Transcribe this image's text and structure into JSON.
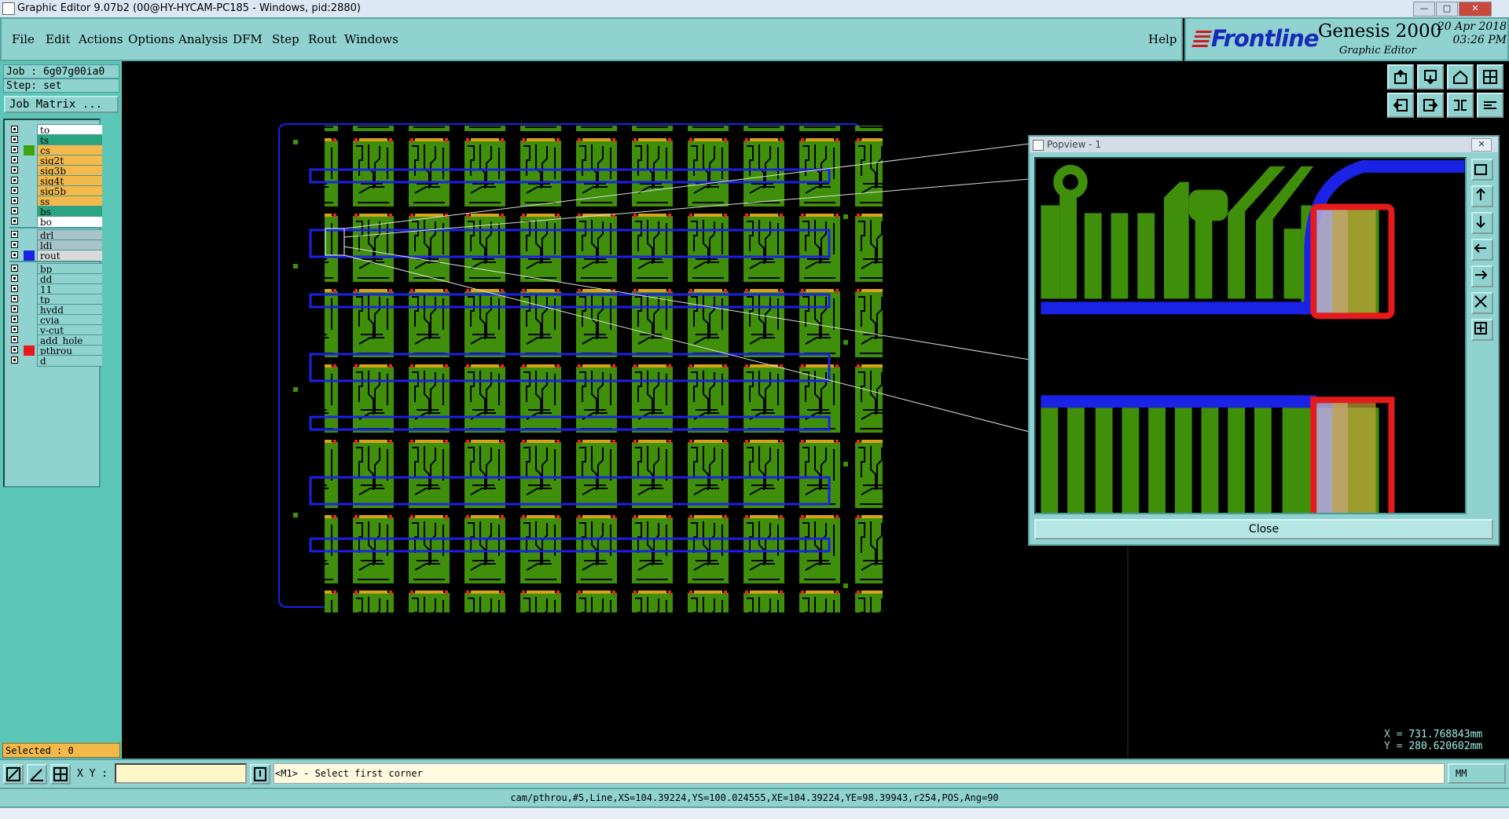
{
  "window": {
    "title": "Graphic Editor 9.07b2 (00@HY-HYCAM-PC185 - Windows, pid:2880)"
  },
  "menu": {
    "items": [
      "File",
      "Edit",
      "Actions",
      "Options",
      "Analysis",
      "DFM",
      "Step",
      "Rout",
      "Windows"
    ],
    "help": "Help"
  },
  "brand": {
    "logo": "Frontline",
    "product": "Genesis 2000",
    "subtitle": "Graphic Editor",
    "date": "20 Apr 2018",
    "time": "03:26 PM"
  },
  "job": {
    "job_line": "Job : 6g07g00ia0",
    "step_line": "Step: set",
    "matrix_button": "Job Matrix ..."
  },
  "layers": {
    "group1": [
      {
        "name": "to",
        "bg": "#ffffff",
        "swatch": ""
      },
      {
        "name": "ts",
        "bg": "#2aa57f",
        "swatch": ""
      },
      {
        "name": "cs",
        "bg": "#f4b94b",
        "swatch": "#3ea30e"
      },
      {
        "name": "sig2t",
        "bg": "#f4b94b",
        "swatch": ""
      },
      {
        "name": "sig3b",
        "bg": "#f4b94b",
        "swatch": ""
      },
      {
        "name": "sig4t",
        "bg": "#f4b94b",
        "swatch": ""
      },
      {
        "name": "sig5b",
        "bg": "#f4b94b",
        "swatch": ""
      },
      {
        "name": "ss",
        "bg": "#f4b94b",
        "swatch": ""
      },
      {
        "name": "bs",
        "bg": "#2aa57f",
        "swatch": ""
      },
      {
        "name": "bo",
        "bg": "#ffffff",
        "swatch": ""
      }
    ],
    "group2": [
      {
        "name": "drl",
        "bg": "#a9c4c8",
        "swatch": ""
      },
      {
        "name": "ldi",
        "bg": "#a9c4c8",
        "swatch": ""
      },
      {
        "name": "rout",
        "bg": "#d9d9d9",
        "swatch": "#1a22e6"
      }
    ],
    "group3": [
      {
        "name": "bp",
        "bg": "#8fd2d0",
        "swatch": ""
      },
      {
        "name": "dd",
        "bg": "#8fd2d0",
        "swatch": ""
      },
      {
        "name": "11",
        "bg": "#8fd2d0",
        "swatch": ""
      },
      {
        "name": "tp",
        "bg": "#8fd2d0",
        "swatch": ""
      },
      {
        "name": "hydd",
        "bg": "#8fd2d0",
        "swatch": ""
      },
      {
        "name": "cvia",
        "bg": "#8fd2d0",
        "swatch": ""
      },
      {
        "name": "v-cut",
        "bg": "#8fd2d0",
        "swatch": ""
      },
      {
        "name": "add_hole",
        "bg": "#8fd2d0",
        "swatch": ""
      },
      {
        "name": "pthrou",
        "bg": "#8fd2d0",
        "swatch": "#e61a1a"
      },
      {
        "name": "d",
        "bg": "#8fd2d0",
        "swatch": ""
      }
    ]
  },
  "selected": "Selected : 0",
  "popview": {
    "title": "Popview - 1",
    "close_label": "Close"
  },
  "coords": {
    "x_label": "X =",
    "x_value": "731.768843mm",
    "y_label": "Y =",
    "y_value": "280.620602mm"
  },
  "command": {
    "xy_label": "X Y :",
    "xy_value": "",
    "message": "<M1> - Select first corner",
    "units": "MM"
  },
  "status": "cam/pthrou,#5,Line,XS=104.39224,YS=100.024555,XE=104.39224,YE=98.39943,r254,POS,Ang=90",
  "colors": {
    "panel": "#8fd2d0",
    "copper": "#3f8f0a",
    "rout": "#1a22e6",
    "pthrou": "#e61a1a"
  }
}
